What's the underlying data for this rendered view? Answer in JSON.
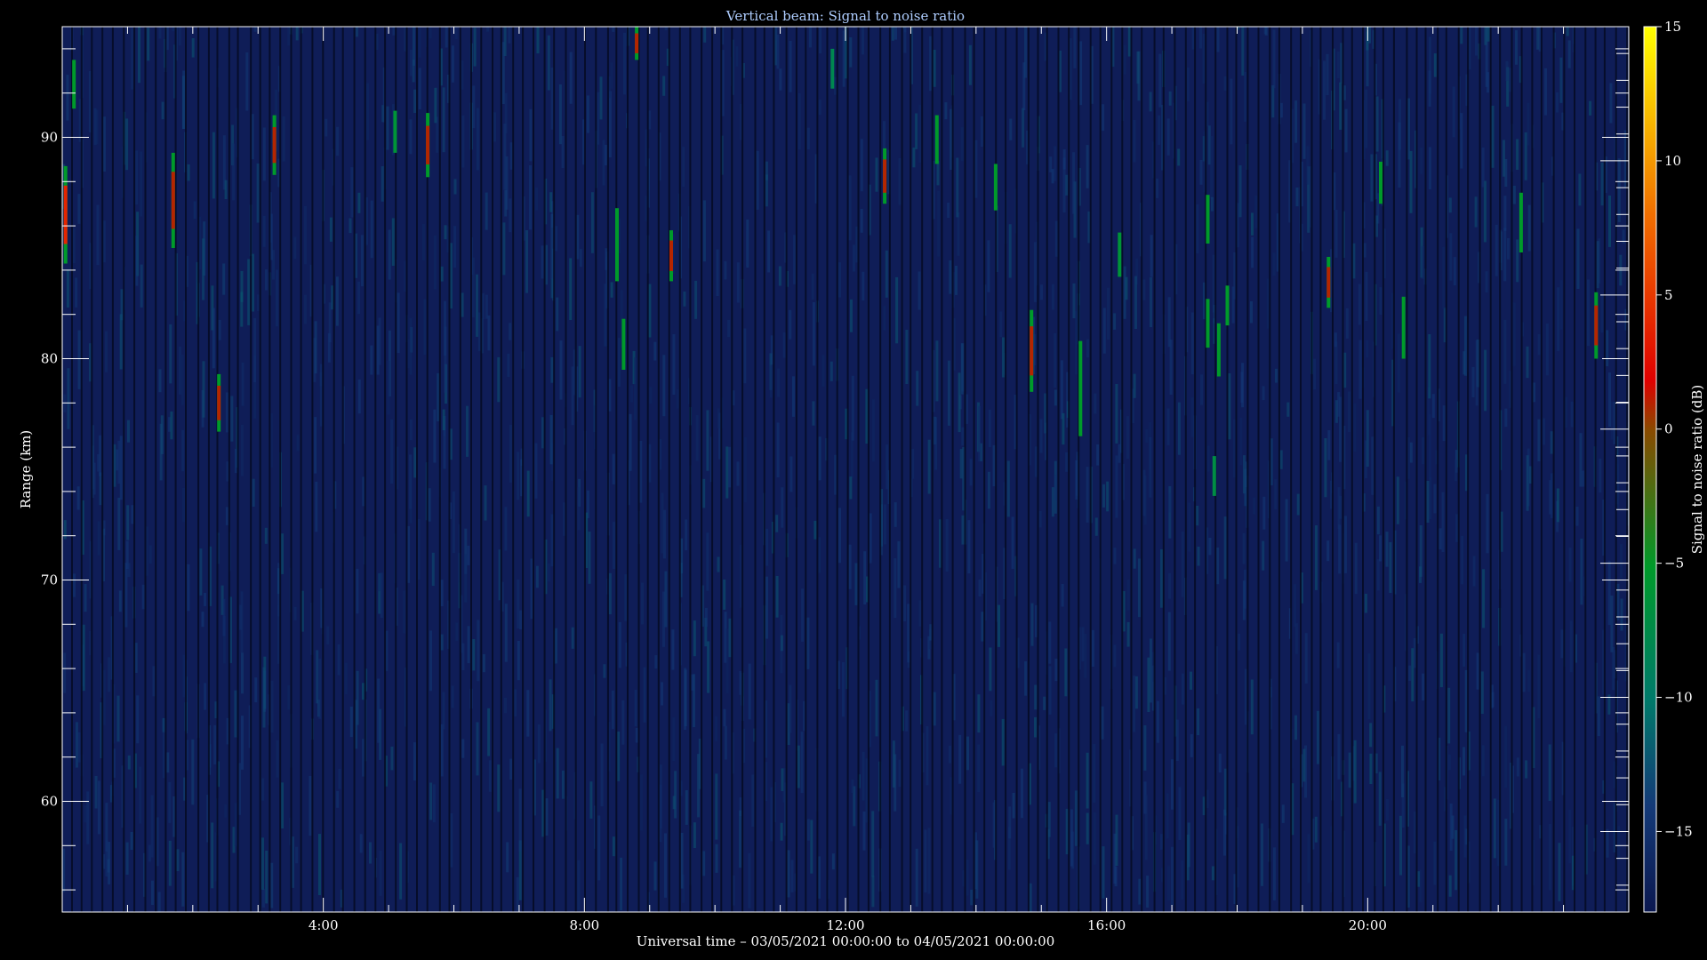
{
  "chart_data": {
    "type": "heatmap",
    "title": "Vertical beam: Signal to noise ratio",
    "xlabel": "Universal time – 03/05/2021 00:00:00 to 04/05/2021 00:00:00",
    "ylabel": "Range (km)",
    "colorbar_label": "Signal to noise ratio (dB)",
    "x_unit": "hours UT",
    "xlim": [
      0,
      24
    ],
    "ylim": [
      55,
      95
    ],
    "x_ticks": [
      {
        "value": 4,
        "label": "4:00"
      },
      {
        "value": 8,
        "label": "8:00"
      },
      {
        "value": 12,
        "label": "12:00"
      },
      {
        "value": 16,
        "label": "16:00"
      },
      {
        "value": 20,
        "label": "20:00"
      }
    ],
    "y_ticks": [
      {
        "value": 60,
        "label": "60"
      },
      {
        "value": 70,
        "label": "70"
      },
      {
        "value": 80,
        "label": "80"
      },
      {
        "value": 90,
        "label": "90"
      }
    ],
    "colorbar_range": [
      -18,
      15
    ],
    "colorbar_ticks": [
      {
        "value": 15,
        "label": "15"
      },
      {
        "value": 10,
        "label": "10"
      },
      {
        "value": 5,
        "label": "5"
      },
      {
        "value": 0,
        "label": "0"
      },
      {
        "value": -5,
        "label": "−5"
      },
      {
        "value": -10,
        "label": "−10"
      },
      {
        "value": -15,
        "label": "−15"
      }
    ],
    "background_snr": -15,
    "colormap": [
      {
        "value": -18,
        "color": "#0b1850"
      },
      {
        "value": -14,
        "color": "#143a78"
      },
      {
        "value": -10,
        "color": "#007a6a"
      },
      {
        "value": -5,
        "color": "#009a2a"
      },
      {
        "value": 0,
        "color": "#8a4a00"
      },
      {
        "value": 2,
        "color": "#e00000"
      },
      {
        "value": 8,
        "color": "#f07000"
      },
      {
        "value": 15,
        "color": "#ffff00"
      }
    ],
    "echoes": [
      {
        "t": 0.05,
        "r0": 84.3,
        "r1": 88.7,
        "snr": 4
      },
      {
        "t": 0.18,
        "r0": 91.3,
        "r1": 93.5,
        "snr": -5
      },
      {
        "t": 1.7,
        "r0": 85.0,
        "r1": 89.3,
        "snr": 1
      },
      {
        "t": 2.4,
        "r0": 76.7,
        "r1": 79.3,
        "snr": 1
      },
      {
        "t": 3.25,
        "r0": 88.3,
        "r1": 91.0,
        "snr": 1
      },
      {
        "t": 5.1,
        "r0": 89.3,
        "r1": 91.2,
        "snr": -6
      },
      {
        "t": 5.6,
        "r0": 88.2,
        "r1": 91.1,
        "snr": 1
      },
      {
        "t": 8.5,
        "r0": 83.5,
        "r1": 86.8,
        "snr": -5
      },
      {
        "t": 8.6,
        "r0": 79.5,
        "r1": 81.8,
        "snr": -5
      },
      {
        "t": 8.8,
        "r0": 93.5,
        "r1": 95.0,
        "snr": 1
      },
      {
        "t": 9.33,
        "r0": 83.5,
        "r1": 85.8,
        "snr": 1
      },
      {
        "t": 11.8,
        "r0": 92.2,
        "r1": 94.0,
        "snr": -8
      },
      {
        "t": 12.6,
        "r0": 87.0,
        "r1": 89.5,
        "snr": 1
      },
      {
        "t": 13.4,
        "r0": 88.8,
        "r1": 91.0,
        "snr": -5
      },
      {
        "t": 14.3,
        "r0": 86.7,
        "r1": 88.8,
        "snr": -5
      },
      {
        "t": 14.85,
        "r0": 78.5,
        "r1": 82.2,
        "snr": 1
      },
      {
        "t": 15.6,
        "r0": 76.5,
        "r1": 80.8,
        "snr": -5
      },
      {
        "t": 16.2,
        "r0": 83.7,
        "r1": 85.7,
        "snr": -6
      },
      {
        "t": 17.55,
        "r0": 85.2,
        "r1": 87.4,
        "snr": -3
      },
      {
        "t": 17.55,
        "r0": 80.5,
        "r1": 82.7,
        "snr": -4
      },
      {
        "t": 17.72,
        "r0": 79.2,
        "r1": 81.6,
        "snr": -5
      },
      {
        "t": 17.85,
        "r0": 81.5,
        "r1": 83.3,
        "snr": -5
      },
      {
        "t": 17.65,
        "r0": 73.8,
        "r1": 75.6,
        "snr": -7
      },
      {
        "t": 19.4,
        "r0": 82.3,
        "r1": 84.6,
        "snr": 1
      },
      {
        "t": 20.2,
        "r0": 87.0,
        "r1": 88.9,
        "snr": -5
      },
      {
        "t": 20.55,
        "r0": 80.0,
        "r1": 82.8,
        "snr": -5
      },
      {
        "t": 22.35,
        "r0": 84.8,
        "r1": 87.5,
        "snr": -4
      },
      {
        "t": 23.5,
        "r0": 80.0,
        "r1": 83.0,
        "snr": 1
      }
    ]
  }
}
